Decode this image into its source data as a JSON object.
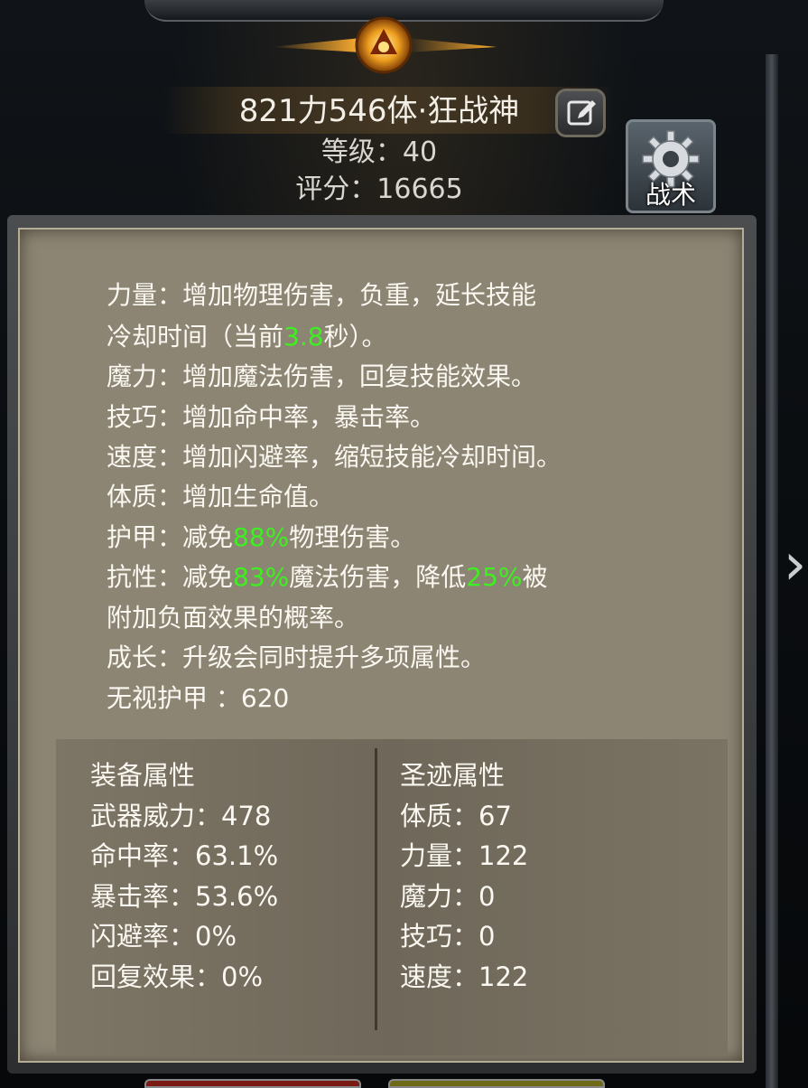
{
  "header": {
    "character_name": "821力546体·狂战神",
    "level_text": "等级：40",
    "score_text": "评分：16665",
    "tactics_label": "战术"
  },
  "description": {
    "line1": "力量：增加物理伤害，负重，延长技能",
    "line2_a": "冷却时间（当前",
    "line2_value": "3.8",
    "line2_b": "秒）。",
    "line3": "魔力：增加魔法伤害，回复技能效果。",
    "line4": "技巧：增加命中率，暴击率。",
    "line5": "速度：增加闪避率，缩短技能冷却时间。",
    "line6": "体质：增加生命值。",
    "line7_a": "护甲：减免",
    "line7_value": "88%",
    "line7_b": "物理伤害。",
    "line8_a": "抗性：减免",
    "line8_value1": "83%",
    "line8_b": "魔法伤害，降低",
    "line8_value2": "25%",
    "line8_c": "被",
    "line9": "附加负面效果的概率。",
    "line10": "成长：升级会同时提升多项属性。",
    "line11": "无视护甲 ：620"
  },
  "equipment": {
    "title": "装备属性",
    "rows": [
      "武器威力：478",
      "命中率：63.1%",
      "暴击率：53.6%",
      "闪避率：0%",
      "回复效果：0%"
    ]
  },
  "relic": {
    "title": "圣迹属性",
    "rows": [
      "体质：67",
      "力量：122",
      "魔力：0",
      "技巧：0",
      "速度：122"
    ]
  },
  "colors": {
    "highlight": "#3df01f",
    "parchment": "#8c8574",
    "text": "#fbf8f1"
  },
  "icons": {
    "edit": "pencil-square-icon",
    "tactics": "gear-icon",
    "emblem": "winged-emblem-icon",
    "next": "chevron-right-icon"
  }
}
